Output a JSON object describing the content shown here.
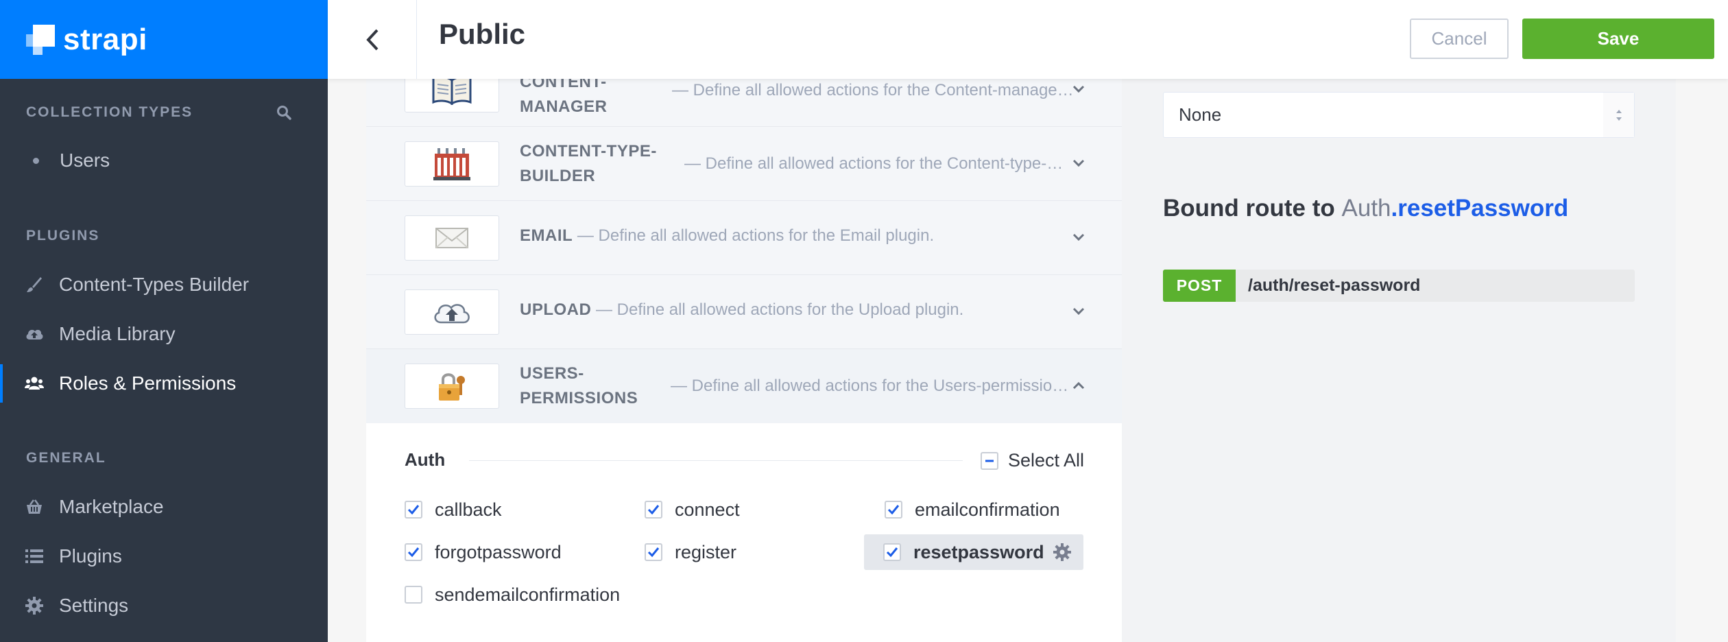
{
  "brand": {
    "name": "strapi"
  },
  "sidebar": {
    "collection_types_title": "COLLECTION TYPES",
    "collection_items": [
      {
        "label": "Users"
      }
    ],
    "plugins_title": "PLUGINS",
    "plugins": [
      {
        "label": "Content-Types Builder",
        "icon": "brush-icon"
      },
      {
        "label": "Media Library",
        "icon": "cloud-upload-icon"
      },
      {
        "label": "Roles & Permissions",
        "icon": "users-icon",
        "active": true
      }
    ],
    "general_title": "GENERAL",
    "general": [
      {
        "label": "Marketplace",
        "icon": "basket-icon"
      },
      {
        "label": "Plugins",
        "icon": "list-icon"
      },
      {
        "label": "Settings",
        "icon": "gear-icon"
      }
    ]
  },
  "header": {
    "title": "Public",
    "cancel_label": "Cancel",
    "save_label": "Save"
  },
  "plugin_rows": [
    {
      "name_line1": "CONTENT-",
      "name_line2": "MANAGER",
      "description": "— Define all allowed actions for the Content-manage…",
      "icon": "book-icon",
      "expanded": false
    },
    {
      "name_line1": "CONTENT-TYPE-",
      "name_line2": "BUILDER",
      "description": "— Define all allowed actions for the Content-type-…",
      "icon": "factory-icon",
      "expanded": false
    },
    {
      "name": "EMAIL",
      "description": "— Define all allowed actions for the Email plugin.",
      "icon": "envelope-icon",
      "expanded": false
    },
    {
      "name": "UPLOAD",
      "description": "— Define all allowed actions for the Upload plugin.",
      "icon": "cloud-upload-icon",
      "expanded": false
    },
    {
      "name_line1": "USERS-",
      "name_line2": "PERMISSIONS",
      "description": "— Define all allowed actions for the Users-permissio…",
      "icon": "padlock-icon",
      "expanded": true
    }
  ],
  "auth": {
    "title": "Auth",
    "select_all_label": "Select All",
    "actions": [
      {
        "label": "callback",
        "checked": true
      },
      {
        "label": "connect",
        "checked": true
      },
      {
        "label": "emailconfirmation",
        "checked": true
      },
      {
        "label": "forgotpassword",
        "checked": true
      },
      {
        "label": "register",
        "checked": true
      },
      {
        "label": "resetpassword",
        "checked": true,
        "selected": true
      },
      {
        "label": "sendemailconfirmation",
        "checked": false
      }
    ]
  },
  "policy": {
    "selected": "None",
    "bound_prefix": "Bound route to ",
    "controller": "Auth",
    "action": ".resetPassword",
    "method": "POST",
    "path": "/auth/reset-password"
  },
  "colors": {
    "brand_blue": "#007eff",
    "sidebar_bg": "#2e3744",
    "save_green": "#5bb12f",
    "check_blue": "#1c5de7"
  }
}
